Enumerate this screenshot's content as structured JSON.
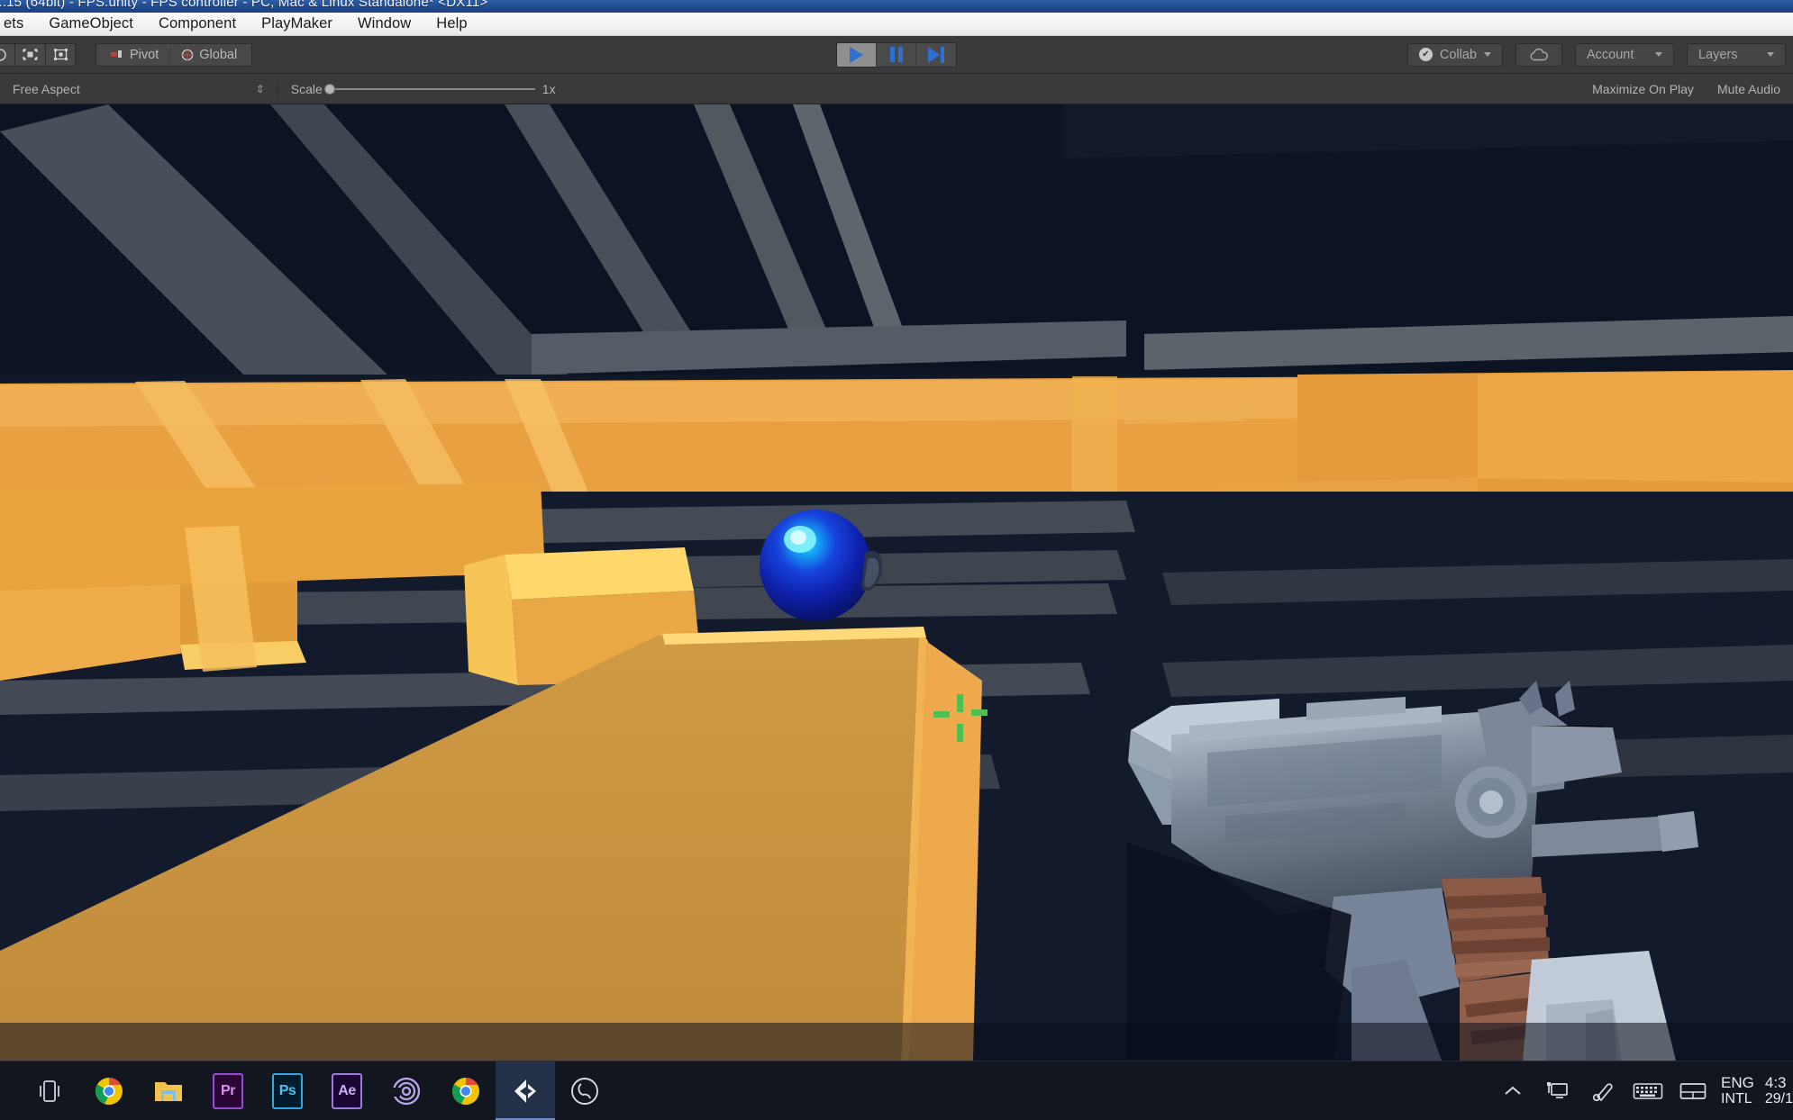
{
  "window": {
    "title": "...15 (64bit) - FPS.unity - FPS controller - PC, Mac & Linux Standalone* <DX11>"
  },
  "menubar": {
    "items": [
      {
        "label": "ets"
      },
      {
        "label": "GameObject"
      },
      {
        "label": "Component"
      },
      {
        "label": "PlayMaker"
      },
      {
        "label": "Window"
      },
      {
        "label": "Help"
      }
    ]
  },
  "toolbar": {
    "tools": [
      {
        "name": "rotate-tool"
      },
      {
        "name": "scale-tool"
      },
      {
        "name": "rect-tool"
      }
    ],
    "pivot_label": "Pivot",
    "handle_label": "Global",
    "play_label": "play",
    "pause_label": "pause",
    "step_label": "step",
    "collab_label": "Collab",
    "cloud_label": "cloud",
    "account_label": "Account",
    "layers_label": "Layers"
  },
  "gameview": {
    "aspect_label": "Free Aspect",
    "scale_label": "Scale",
    "scale_value": "1x",
    "maximize_label": "Maximize On Play",
    "mute_label": "Mute Audio"
  },
  "scene": {
    "crosshair": "crosshair",
    "sphere": "blue-pickup-sphere",
    "weapon": "fps-weapon-model",
    "colors": {
      "background": "#0c1322",
      "platform_orange": "#e8a040",
      "platform_light": "#f7c252",
      "platform_bright": "#ffd76a",
      "platform_shadow": "#d08c32",
      "ramp": "#c9933f",
      "beam_grey": "#5a5f66",
      "sphere_core": "#1a36d8",
      "sphere_highlight": "#3ecfff",
      "crosshair_green": "#4fbf52",
      "gun_metal": "#8e9bad",
      "gun_grip": "#8a5a46"
    }
  },
  "taskbar": {
    "items": [
      {
        "name": "task-view-icon",
        "label": ""
      },
      {
        "name": "chrome-icon",
        "label": ""
      },
      {
        "name": "file-explorer-icon",
        "label": ""
      },
      {
        "name": "premiere-pro-icon",
        "label": "Pr"
      },
      {
        "name": "photoshop-icon",
        "label": "Ps"
      },
      {
        "name": "after-effects-icon",
        "label": "Ae"
      },
      {
        "name": "bittorrent-icon",
        "label": ""
      },
      {
        "name": "chrome-icon-2",
        "label": ""
      },
      {
        "name": "unity-icon",
        "label": ""
      },
      {
        "name": "obs-icon",
        "label": ""
      }
    ],
    "tray": {
      "chevron": "▲",
      "icons": [
        "network-icon",
        "pen-icon",
        "keyboard-icon",
        "touchpad-icon"
      ],
      "language_line1": "ENG",
      "language_line2": "INTL",
      "time": "4:3",
      "date": "29/1"
    }
  }
}
